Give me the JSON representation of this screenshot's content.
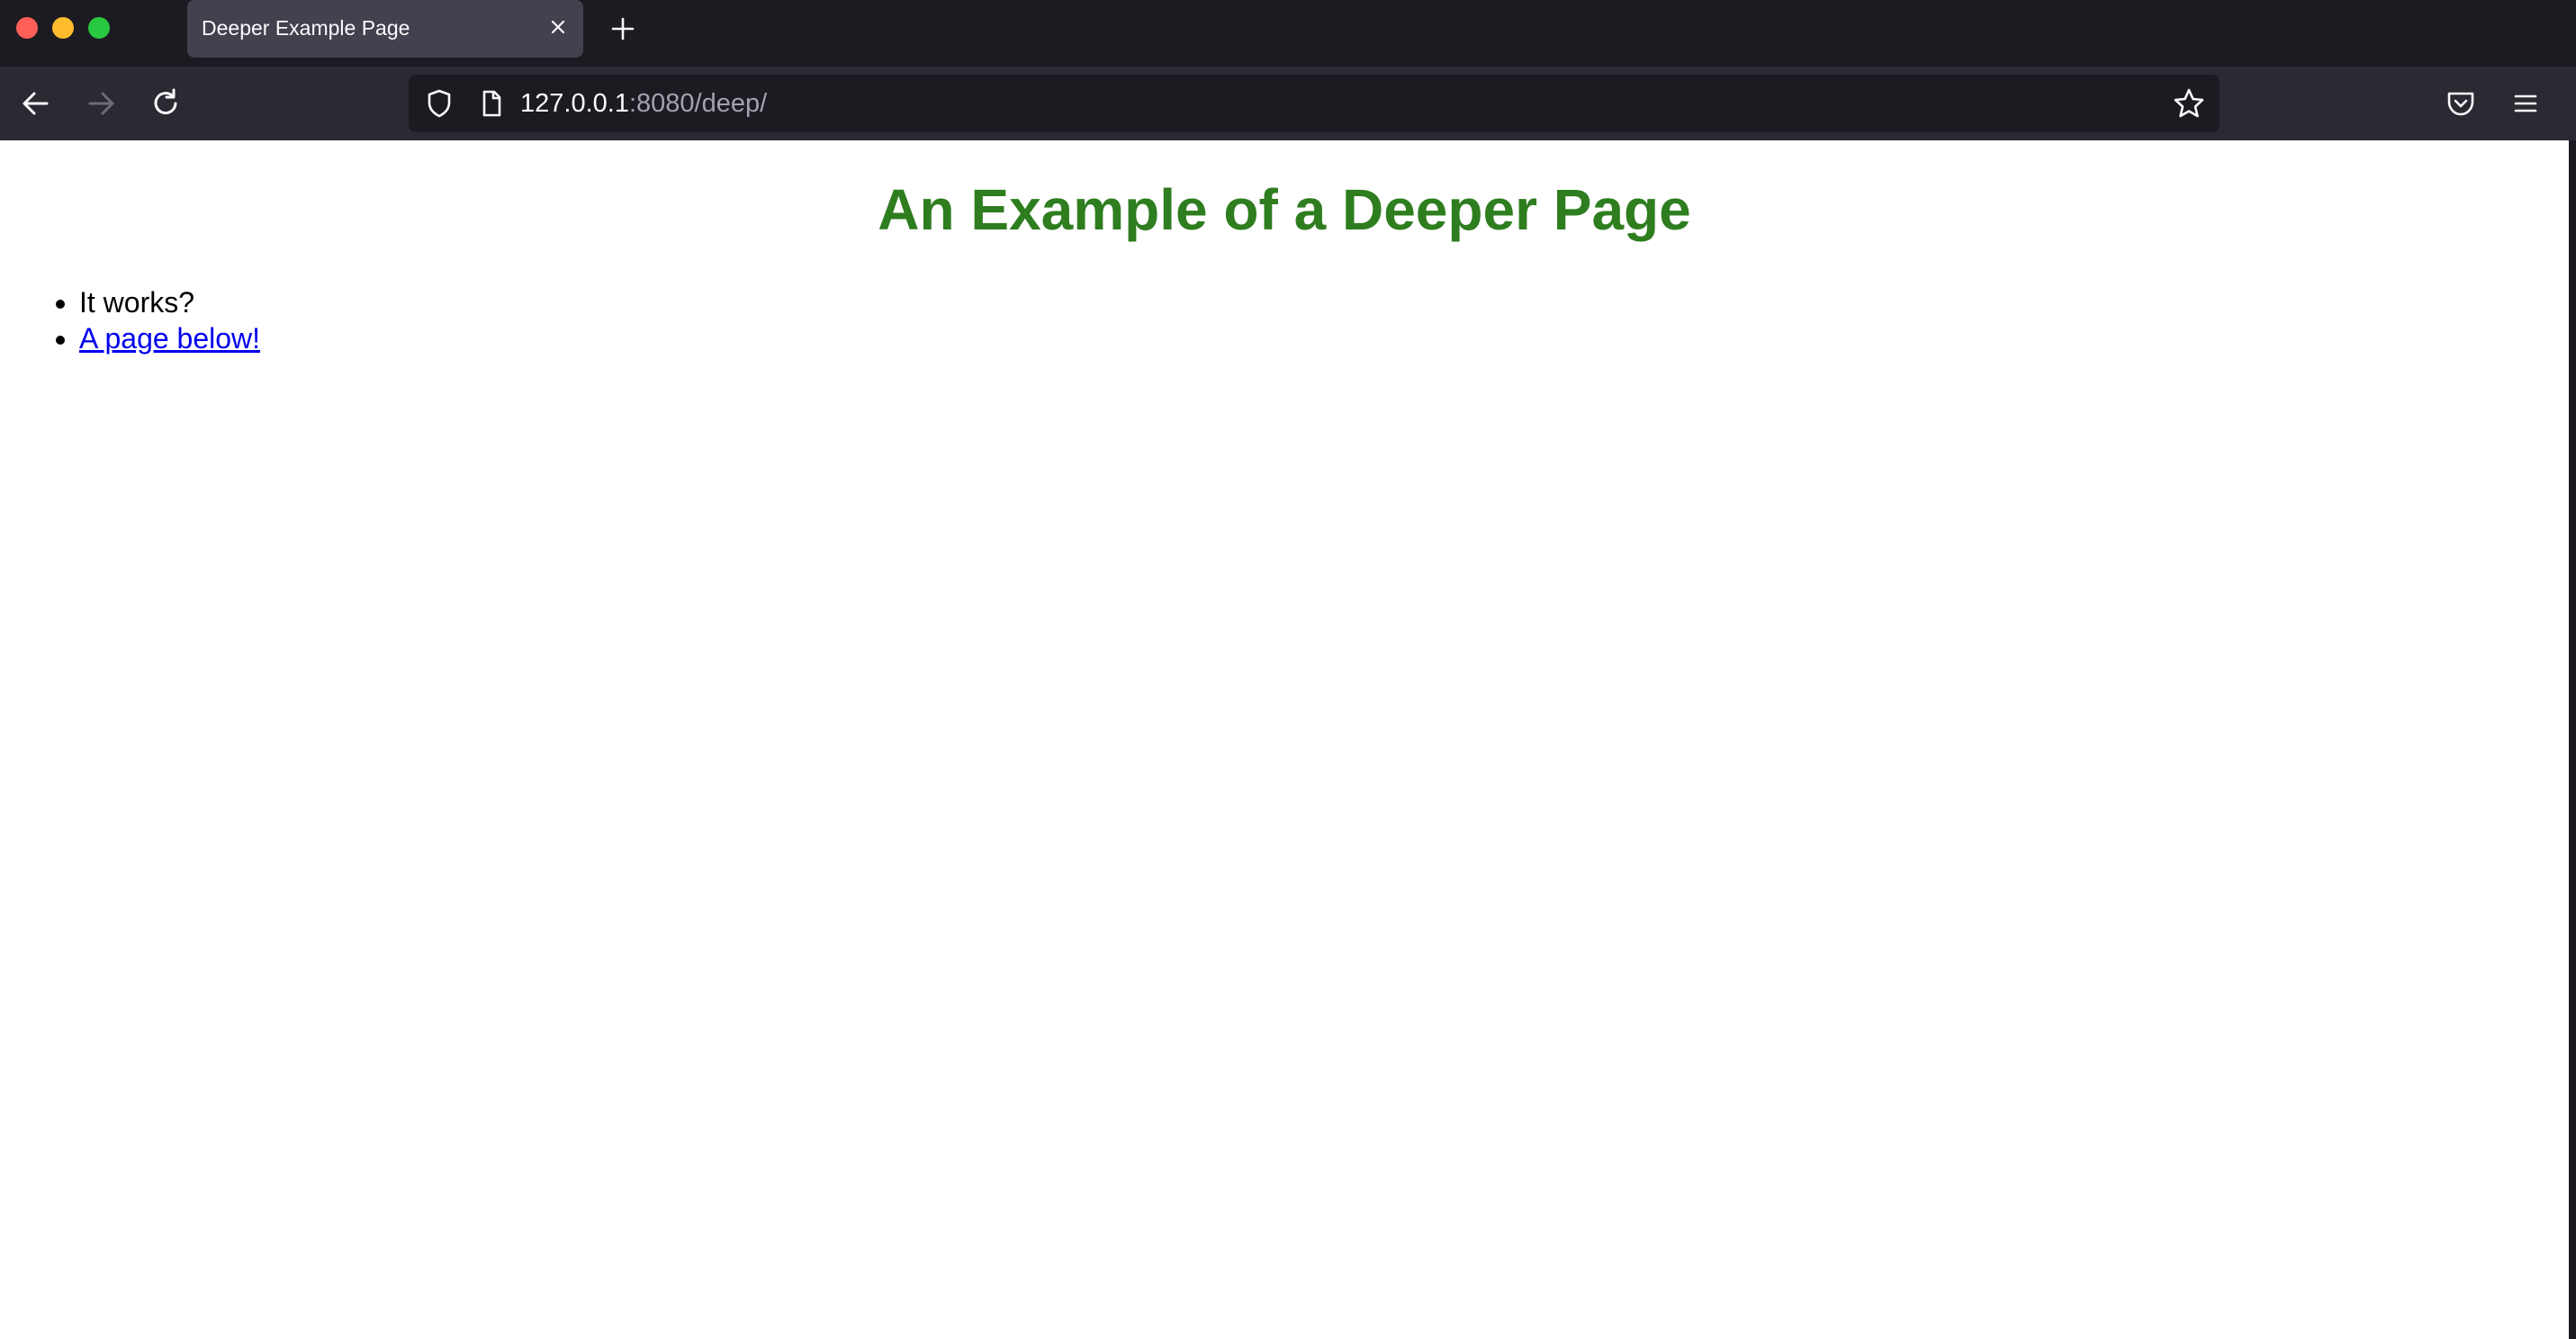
{
  "browser": {
    "tab": {
      "title": "Deeper Example Page"
    },
    "address": {
      "host": "127.0.0.1",
      "rest": ":8080/deep/"
    },
    "icons": {
      "back": "back-arrow-icon",
      "forward": "forward-arrow-icon",
      "reload": "reload-icon",
      "shield": "shield-icon",
      "page": "page-icon",
      "bookmark": "star-icon",
      "pocket": "pocket-icon",
      "menu": "hamburger-menu-icon",
      "close_tab": "close-icon",
      "new_tab": "plus-icon"
    },
    "colors": {
      "chrome": "#1c1b22",
      "toolbar": "#2b2a33",
      "tab_active": "#42414d",
      "close": "#ff5f57",
      "minimize": "#febc2e",
      "maximize": "#28c840"
    }
  },
  "page": {
    "heading": "An Example of a Deeper Page",
    "heading_color": "#2e7d1f",
    "list": [
      {
        "text": "It works?"
      },
      {
        "text": "A page below!"
      }
    ],
    "link_color": "#0000ee"
  }
}
